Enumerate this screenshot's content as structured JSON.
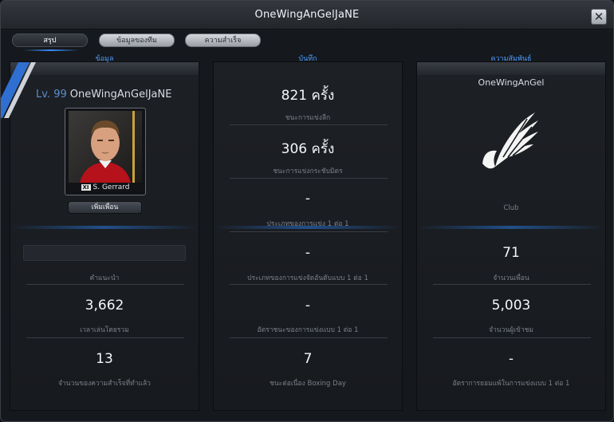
{
  "window": {
    "title": "OneWingAnGelJaNE",
    "close_symbol": "✕"
  },
  "tabs": [
    {
      "label": "สรุป",
      "active": true
    },
    {
      "label": "ข้อมูลของทีม",
      "active": false
    },
    {
      "label": "ความสำเร็จ",
      "active": false
    }
  ],
  "info_panel": {
    "heading": "ข้อมูล",
    "level": "Lv. 99",
    "player_name": "OneWingAnGelJaNE",
    "card": {
      "badge": "XI",
      "name": "S. Gerrard"
    },
    "add_friend_label": "เพิ่มเพื่อน",
    "stats": [
      {
        "value": "",
        "label": "คำแนะนำ"
      },
      {
        "value": "3,662",
        "label": "เวลาเล่นโดยรวม"
      },
      {
        "value": "13",
        "label": "จำนวนของความสำเร็จที่ทำแล้ว"
      }
    ]
  },
  "record_panel": {
    "heading": "บันทึก",
    "stats": [
      {
        "value": "821 ครั้ง",
        "label": "ชนะการแข่งลีก"
      },
      {
        "value": "306 ครั้ง",
        "label": "ชนะการแข่งกระชับมิตร"
      },
      {
        "value": "-",
        "label": "ประเภทของการแข่ง 1 ต่อ 1"
      },
      {
        "value": "-",
        "label": "ประเภทของการแข่งจัดอันดับแบบ 1 ต่อ 1"
      },
      {
        "value": "-",
        "label": "อัตราชนะของการแข่งแบบ 1 ต่อ 1"
      },
      {
        "value": "7",
        "label": "ชนะต่อเนื่อง Boxing Day"
      }
    ]
  },
  "relation_panel": {
    "heading": "ความสัมพันธ์",
    "club_name": "OneWingAnGel",
    "club_caption": "Club",
    "stats": [
      {
        "value": "71",
        "label": "จำนวนเพื่อน"
      },
      {
        "value": "5,003",
        "label": "จำนวนผู้เข้าชม"
      },
      {
        "value": "-",
        "label": "อัตราการยอมแพ้ในการแข่งแบบ 1 ต่อ 1"
      }
    ]
  },
  "colors": {
    "accent": "#4f9dff",
    "level": "#5a8fcc"
  }
}
